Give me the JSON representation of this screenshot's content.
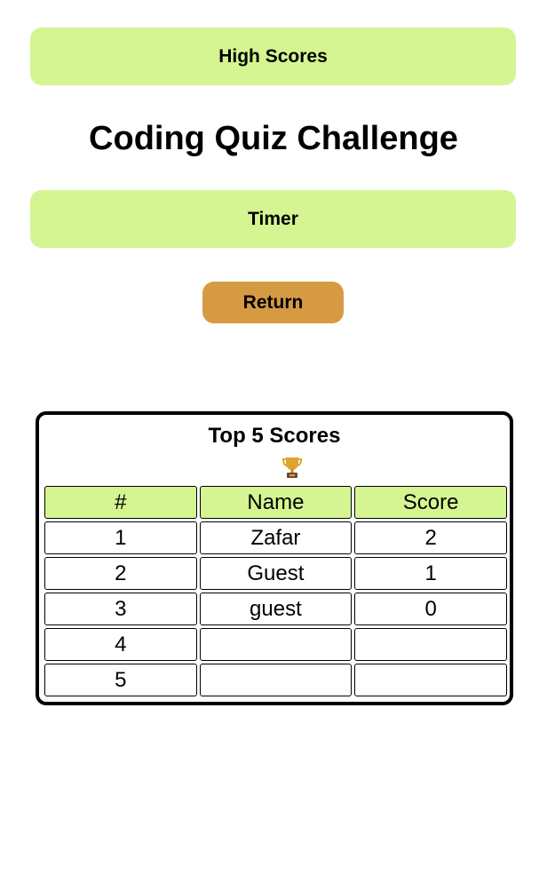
{
  "header": {
    "high_scores_label": "High Scores",
    "title": "Coding Quiz Challenge",
    "timer_label": "Timer",
    "return_label": "Return"
  },
  "scoreboard": {
    "title": "Top 5 Scores",
    "icon": "trophy-icon",
    "columns": [
      "#",
      "Name",
      "Score"
    ],
    "rows": [
      {
        "rank": "1",
        "name": "Zafar",
        "score": "2"
      },
      {
        "rank": "2",
        "name": "Guest",
        "score": "1"
      },
      {
        "rank": "3",
        "name": "guest",
        "score": "0"
      },
      {
        "rank": "4",
        "name": "",
        "score": ""
      },
      {
        "rank": "5",
        "name": "",
        "score": ""
      }
    ]
  },
  "colors": {
    "bar_green": "#d4f592",
    "return_orange": "#d69a42"
  }
}
